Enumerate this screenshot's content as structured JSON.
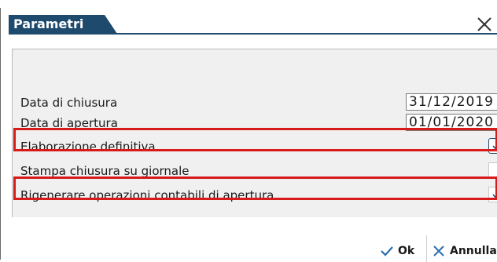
{
  "dialog": {
    "title": "Parametri",
    "close_icon": "close-icon"
  },
  "fields": {
    "data_chiusura": {
      "label": "Data di chiusura",
      "value": "31/12/2019"
    },
    "data_apertura": {
      "label": "Data di apertura",
      "value": "01/01/2020"
    }
  },
  "options": [
    {
      "label": "Elaborazione definitiva",
      "checked": true
    },
    {
      "label": "Stampa chiusura su giornale",
      "checked": false
    },
    {
      "label": "Rigenerare operazioni contabili di apertura",
      "checked": true
    }
  ],
  "buttons": {
    "ok_label": "Ok",
    "cancel_label": "Annulla"
  },
  "colors": {
    "title_bar": "#1e4a6e",
    "highlight": "#d71a1a",
    "panel_bg": "#f0f0f0"
  }
}
